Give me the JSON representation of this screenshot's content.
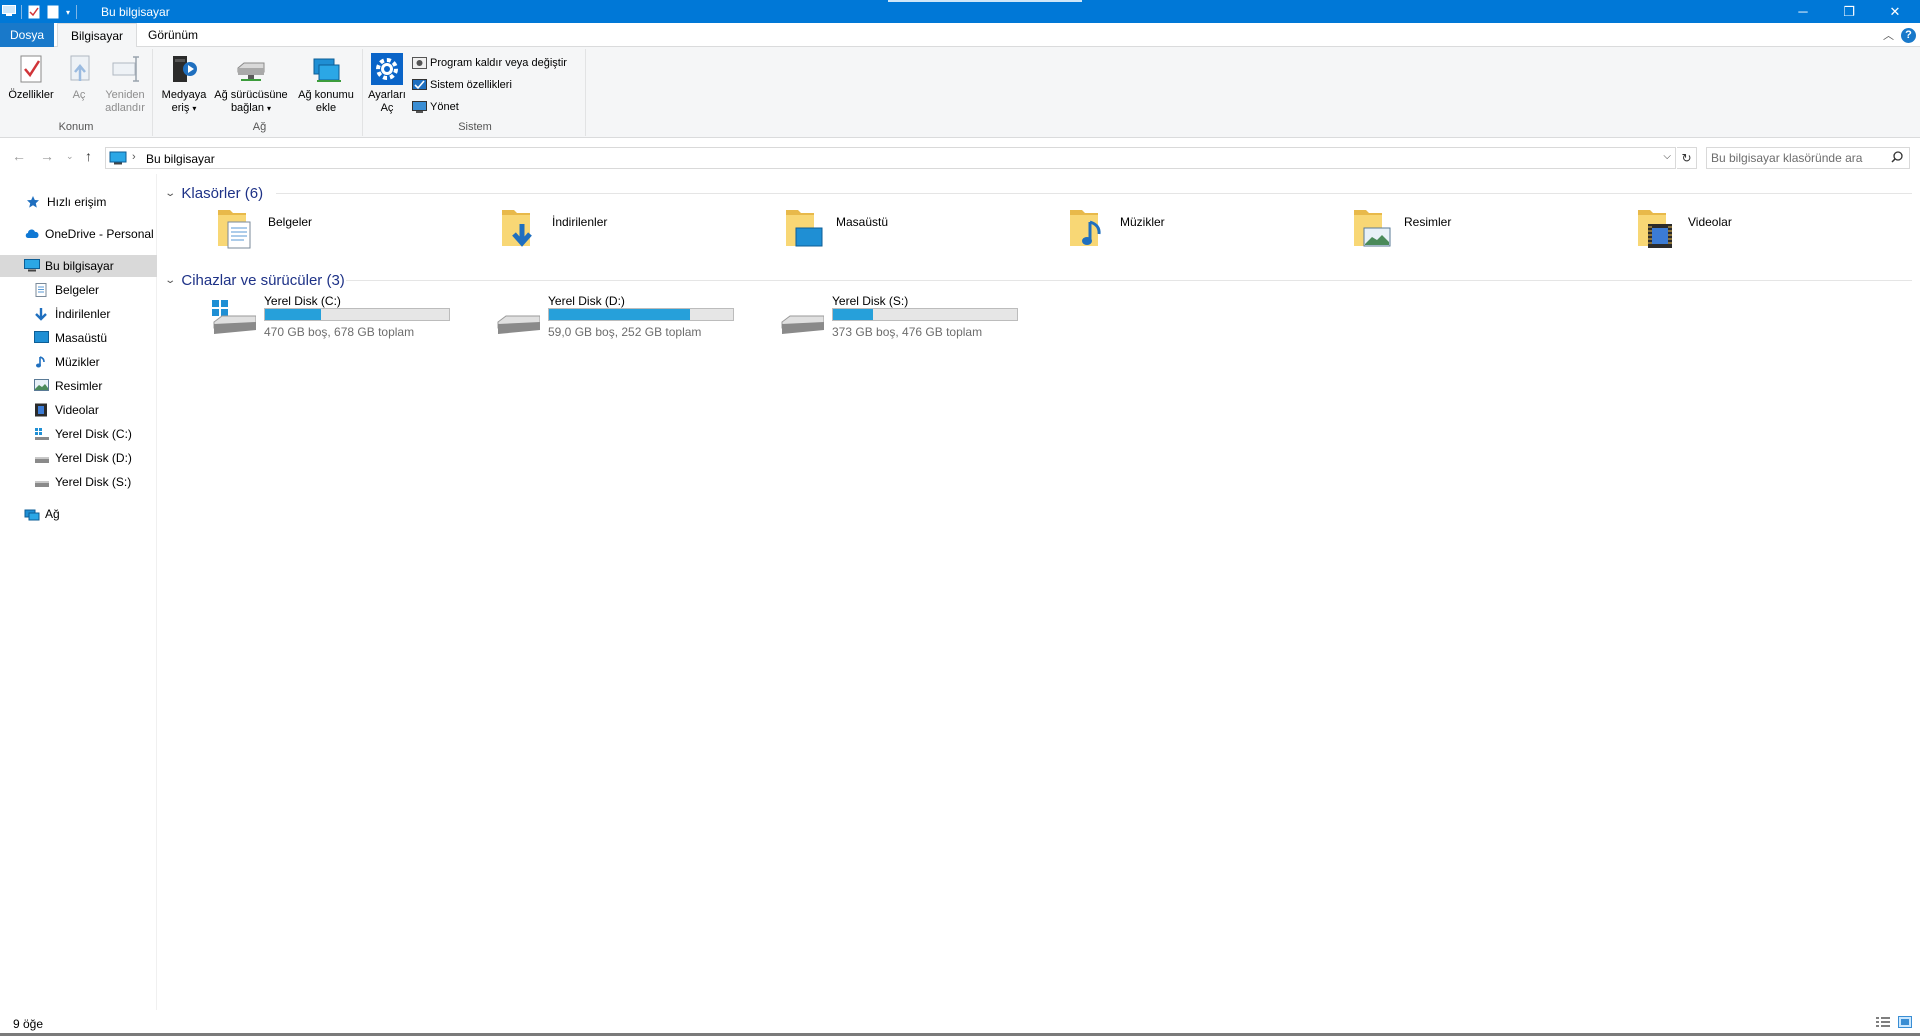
{
  "window": {
    "title": "Bu bilgisayar",
    "controls": {
      "minimize": "─",
      "restore": "❐",
      "close": "✕"
    }
  },
  "ribbon_tabs": {
    "file": "Dosya",
    "computer": "Bilgisayar",
    "view": "Görünüm",
    "help": "?"
  },
  "ribbon": {
    "konum": {
      "label": "Konum",
      "properties": "Özellikler",
      "open": "Aç",
      "rename_1": "Yeniden",
      "rename_2": "adlandır"
    },
    "ag": {
      "label": "Ağ",
      "media_1": "Medyaya",
      "media_2": "eriş",
      "map_drive_1": "Ağ sürücüsüne",
      "map_drive_2": "bağlan",
      "add_location_1": "Ağ konumu",
      "add_location_2": "ekle"
    },
    "sistem": {
      "label": "Sistem",
      "settings_1": "Ayarları",
      "settings_2": "Aç",
      "uninstall": "Program kaldır veya değiştir",
      "sys_props": "Sistem özellikleri",
      "manage": "Yönet"
    }
  },
  "address": {
    "crumb": "Bu bilgisayar",
    "search_placeholder": "Bu bilgisayar klasöründe ara"
  },
  "sidebar": {
    "quick_access": "Hızlı erişim",
    "onedrive": "OneDrive - Personal",
    "this_pc": "Bu bilgisayar",
    "documents": "Belgeler",
    "downloads": "İndirilenler",
    "desktop": "Masaüstü",
    "music": "Müzikler",
    "pictures": "Resimler",
    "videos": "Videolar",
    "disk_c": "Yerel Disk (C:)",
    "disk_d": "Yerel Disk (D:)",
    "disk_s": "Yerel Disk (S:)",
    "network": "Ağ"
  },
  "content": {
    "folders_header": "Klasörler (6)",
    "drives_header": "Cihazlar ve sürücüler (3)",
    "folders": {
      "documents": "Belgeler",
      "downloads": "İndirilenler",
      "desktop": "Masaüstü",
      "music": "Müzikler",
      "pictures": "Resimler",
      "videos": "Videolar"
    },
    "drives": {
      "c": {
        "name": "Yerel Disk (C:)",
        "info": "470 GB boş, 678 GB toplam",
        "used_fraction": 0.307
      },
      "d": {
        "name": "Yerel Disk (D:)",
        "info": "59,0 GB boş, 252 GB toplam",
        "used_fraction": 0.766
      },
      "s": {
        "name": "Yerel Disk (S:)",
        "info": "373 GB boş, 476 GB toplam",
        "used_fraction": 0.216
      }
    }
  },
  "statusbar": {
    "count": "9 öğe"
  },
  "colors": {
    "titlebar": "#0078d7",
    "file_tab": "#1979ca",
    "group_header": "#1e3287",
    "drive_bar": "#26a0da",
    "folder_yellow": "#f8d775"
  }
}
